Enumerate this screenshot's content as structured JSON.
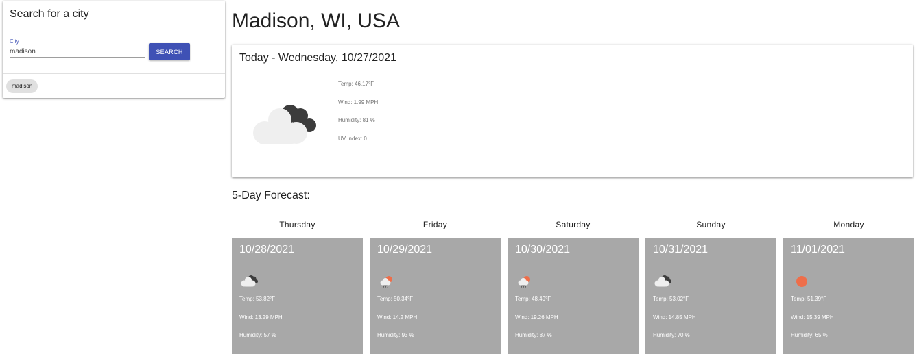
{
  "search": {
    "title": "Search for a city",
    "label": "City",
    "value": "madison",
    "button": "SEARCH"
  },
  "history": [
    "madison"
  ],
  "city": "Madison, WI, USA",
  "today": {
    "heading": "Today - Wednesday, 10/27/2021",
    "icon": "cloudy-icon",
    "temp": "Temp: 46.17°F",
    "wind": "Wind: 1.99 MPH",
    "humidity": "Humidity: 81 %",
    "uv": "UV Index: 0"
  },
  "forecast_heading": "5-Day Forecast:",
  "forecast": [
    {
      "day": "Thursday",
      "date": "10/28/2021",
      "icon": "cloudy-icon",
      "temp": "Temp: 53.82°F",
      "wind": "Wind: 13.29 MPH",
      "humidity": "Humidity: 57 %"
    },
    {
      "day": "Friday",
      "date": "10/29/2021",
      "icon": "rain-sun-icon",
      "temp": "Temp: 50.34°F",
      "wind": "Wind: 14.2 MPH",
      "humidity": "Humidity: 93 %"
    },
    {
      "day": "Saturday",
      "date": "10/30/2021",
      "icon": "rain-sun-icon",
      "temp": "Temp: 48.49°F",
      "wind": "Wind: 19.26 MPH",
      "humidity": "Humidity: 87 %"
    },
    {
      "day": "Sunday",
      "date": "10/31/2021",
      "icon": "cloudy-icon",
      "temp": "Temp: 53.02°F",
      "wind": "Wind: 14.85 MPH",
      "humidity": "Humidity: 70 %"
    },
    {
      "day": "Monday",
      "date": "11/01/2021",
      "icon": "clear-sun-icon",
      "temp": "Temp: 51.39°F",
      "wind": "Wind: 15.39 MPH",
      "humidity": "Humidity: 65 %"
    }
  ],
  "colors": {
    "accent": "#3f51b5",
    "card_gray": "#a8a8a8",
    "sun": "#ee6e4a",
    "cloud_light": "#efefef",
    "cloud_dark": "#3c3c3c"
  }
}
